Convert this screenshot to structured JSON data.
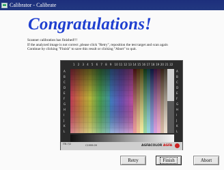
{
  "window": {
    "title": "Calibrator - Calibrate"
  },
  "main": {
    "headline": "Congratulations!",
    "message_lines": [
      "Scanner calibration has finished!!!",
      "If the analyzed image is not correct ,please click \"Retry\", reposition the test target and scan again",
      "Continue by clicking \"Finish\" to save this result or clicking \"Abort\" to quit."
    ]
  },
  "target": {
    "column_numbers": [
      "1",
      "2",
      "3",
      "4",
      "5",
      "6",
      "7",
      "8",
      "9",
      "10",
      "11",
      "12",
      "13",
      "14",
      "15",
      "16",
      "17",
      "18",
      "19",
      "20",
      "21",
      "22"
    ],
    "row_letters": [
      "A",
      "B",
      "C",
      "D",
      "E",
      "F",
      "G",
      "H",
      "I",
      "J",
      "K",
      "L"
    ],
    "footer_label": "IT8.7/2",
    "footer_serial": "C1999:09",
    "brand_text": "AGFACOLOR",
    "brand_accent": "AGFA"
  },
  "buttons": {
    "retry": "Retry",
    "finish": "Finish",
    "abort": "Abort"
  },
  "colors": {
    "title_bar": "#223880",
    "headline": "#1f3fd0"
  }
}
